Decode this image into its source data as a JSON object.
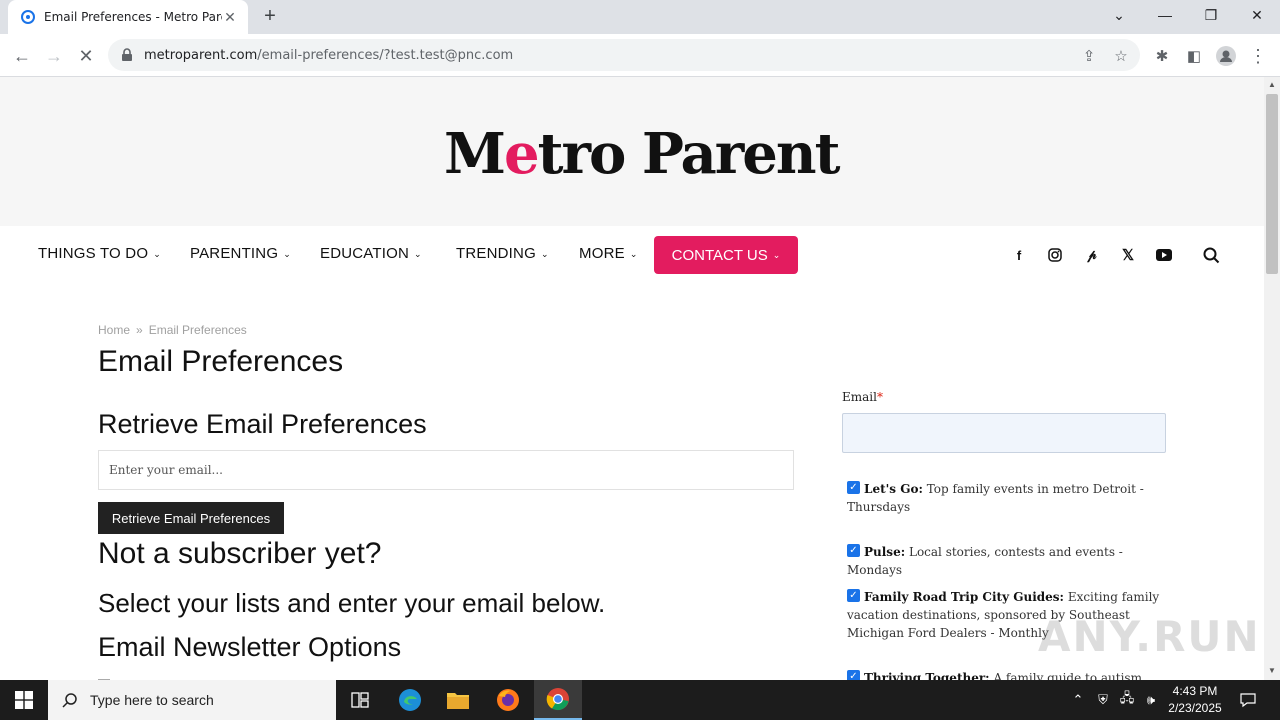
{
  "browser": {
    "tab_title": "Email Preferences - Metro Parent",
    "url_domain": "metroparent.com",
    "url_path": "/email-preferences/?test.test@pnc.com"
  },
  "site": {
    "logo_pre": "M",
    "logo_accent": "e",
    "logo_post": "tro Parent",
    "accent_color": "#e31c5f"
  },
  "nav": {
    "items": [
      "THINGS TO DO",
      "PARENTING",
      "EDUCATION",
      "TRENDING",
      "MORE"
    ],
    "contact": "CONTACT US",
    "social": [
      "facebook-icon",
      "instagram-icon",
      "pinterest-icon",
      "x-icon",
      "youtube-icon"
    ]
  },
  "breadcrumb": {
    "home": "Home",
    "current": "Email Preferences"
  },
  "main": {
    "title": "Email Preferences",
    "retrieve_heading": "Retrieve Email Preferences",
    "email_placeholder": "Enter your email...",
    "retrieve_button": "Retrieve Email Preferences",
    "not_subscriber": "Not a subscriber yet?",
    "select_lists": "Select your lists and enter your email below.",
    "newsletter_options": "Email Newsletter Options"
  },
  "sidebar": {
    "email_label": "Email",
    "required_mark": "*",
    "options": [
      {
        "name": "Let's Go:",
        "desc": "Top family events in metro Detroit - Thursdays",
        "checked": true
      },
      {
        "name": "Pulse:",
        "desc": "Local stories, contests and events - Mondays",
        "checked": true
      },
      {
        "name": "Family Road Trip City Guides:",
        "desc": "Exciting family vacation destinations, sponsored by Southeast Michigan Ford Dealers - Monthly",
        "checked": true
      },
      {
        "name": "Thriving Together:",
        "desc": "A family guide to autism, sponsored",
        "checked": true
      }
    ]
  },
  "watermark": "ANY.RUN",
  "taskbar": {
    "search_placeholder": "Type here to search",
    "time": "4:43 PM",
    "date": "2/23/2025"
  }
}
